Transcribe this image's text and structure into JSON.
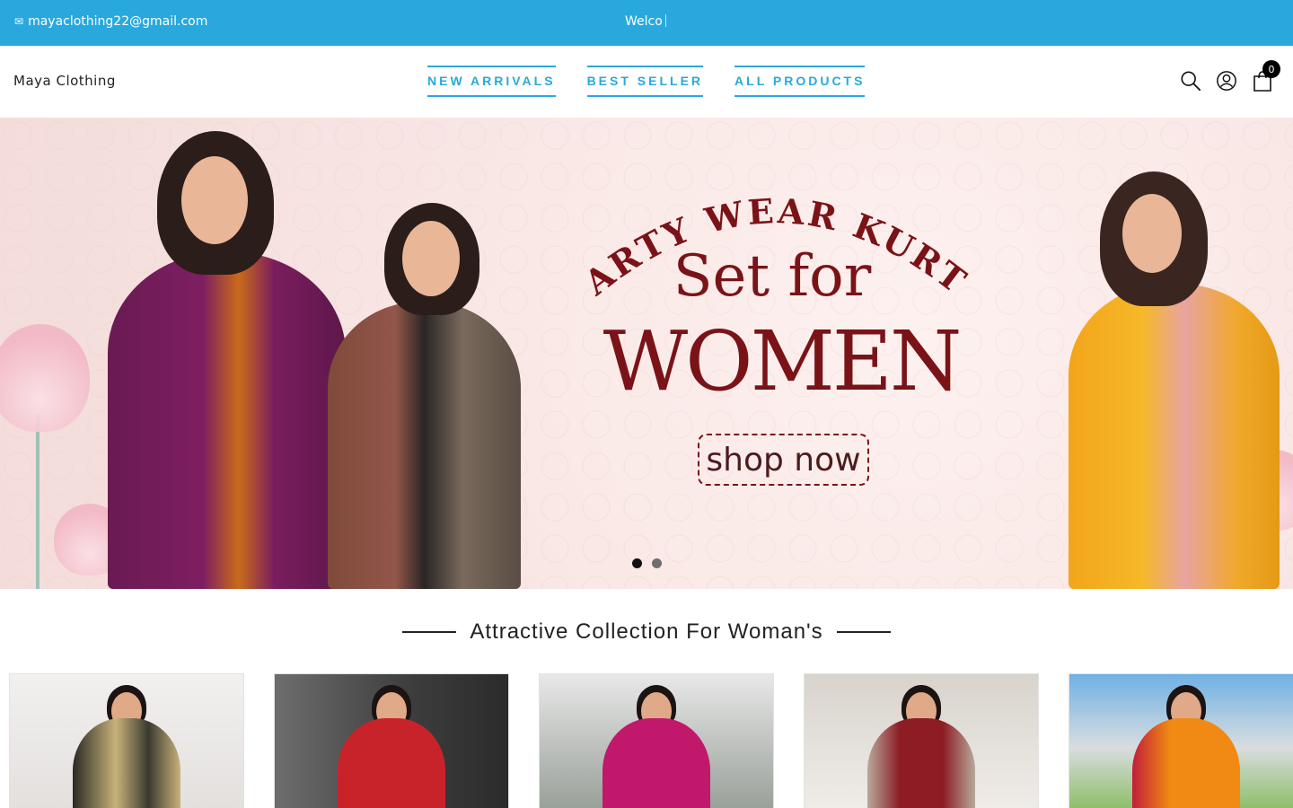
{
  "topbar": {
    "email": "mayaclothing22@gmail.com",
    "email_icon": "mail-icon",
    "marquee_text": "Welco"
  },
  "header": {
    "brand": "Maya Clothing",
    "nav": [
      {
        "label": "NEW ARRIVALS"
      },
      {
        "label": "BEST SELLER"
      },
      {
        "label": "ALL PRODUCTS"
      }
    ],
    "icons": [
      "search-icon",
      "account-icon",
      "cart-icon"
    ],
    "cart_count": "0"
  },
  "hero": {
    "arc_text": "PARTY WEAR KURTA",
    "line2": "Set for",
    "line3": "WOMEN",
    "cta": "shop now",
    "slides_total": 2,
    "active_slide": 1
  },
  "section": {
    "title": "Attractive Collection For Woman's"
  },
  "colors": {
    "accent": "#29a8de",
    "hero_text": "#7a1318",
    "hero_bg": "#f8e5e3"
  },
  "products": [
    {
      "outfit": "#c9b27a",
      "bg": "#eeeceb"
    },
    {
      "outfit": "#c8232b",
      "bg": "#5b5b5b"
    },
    {
      "outfit": "#c2186b",
      "bg": "#c9c9c9"
    },
    {
      "outfit": "#8d1c25",
      "bg": "#e7e3dd"
    },
    {
      "outfit": "#f08a12",
      "bg": "#9cc4e6"
    }
  ]
}
